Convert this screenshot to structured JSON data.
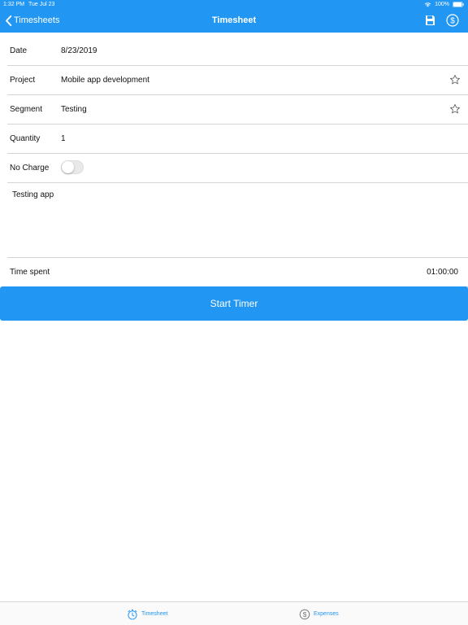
{
  "status_bar": {
    "time": "1:32 PM",
    "date": "Tue Jul 23",
    "battery": "100%"
  },
  "nav": {
    "back_label": "Timesheets",
    "title": "Timesheet",
    "save_icon": "save-icon",
    "dollar_icon": "dollar-circle-icon"
  },
  "form": {
    "date": {
      "label": "Date",
      "value": "8/23/2019"
    },
    "project": {
      "label": "Project",
      "value": "Mobile app development"
    },
    "segment": {
      "label": "Segment",
      "value": "Testing"
    },
    "quantity": {
      "label": "Quantity",
      "value": "1"
    },
    "no_charge": {
      "label": "No Charge",
      "on": false
    },
    "notes": "Testing app",
    "time_spent": {
      "label": "Time spent",
      "value": "01:00:00"
    }
  },
  "start_timer_label": "Start Timer",
  "tab_bar": {
    "tabs": [
      {
        "label": "Timesheet",
        "icon": "stopwatch-icon"
      },
      {
        "label": "Expenses",
        "icon": "dollar-circle-icon"
      }
    ]
  },
  "colors": {
    "accent": "#2196f3",
    "divider": "#d4d4d4"
  }
}
